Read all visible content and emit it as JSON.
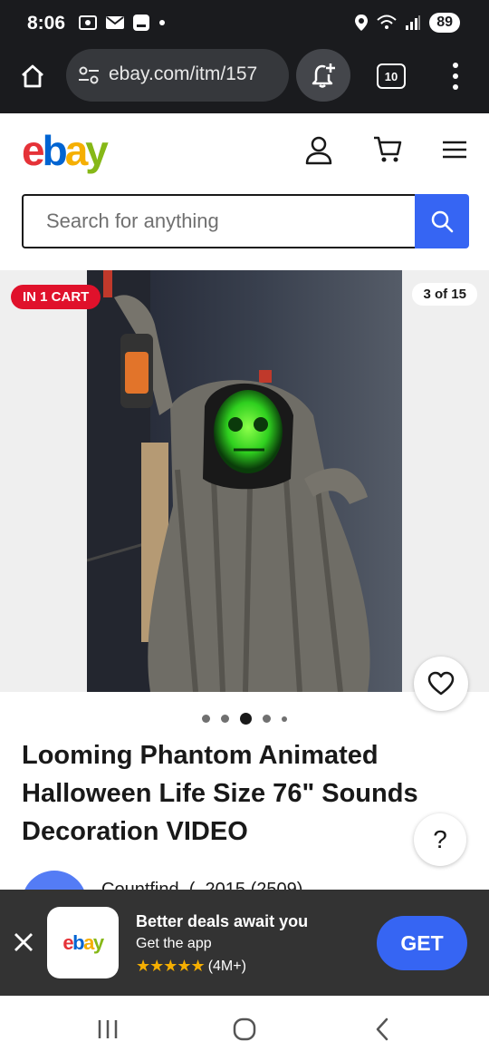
{
  "status_bar": {
    "time": "8:06",
    "battery": "89",
    "icons": [
      "screenshot-icon",
      "mail-icon",
      "message-icon",
      "dot-icon",
      "location-icon",
      "wifi-icon",
      "signal-icon"
    ]
  },
  "browser": {
    "url": "ebay.com/itm/157",
    "tab_count": "10",
    "icons": [
      "home-icon",
      "tune-icon",
      "bell-plus-icon",
      "more-vert-icon"
    ]
  },
  "ebay_header": {
    "logo_letters": [
      "e",
      "b",
      "a",
      "y"
    ],
    "icons": [
      "account-icon",
      "cart-icon",
      "menu-icon"
    ]
  },
  "search": {
    "placeholder": "Search for anything",
    "icons": [
      "search-icon"
    ]
  },
  "gallery": {
    "cart_badge": "IN 1 CART",
    "counter": "3 of 15",
    "dots_total": 5,
    "active_index": 2,
    "icons": [
      "heart-icon"
    ]
  },
  "listing": {
    "title": "Looming Phantom Animated Halloween Life Size 76\" Sounds Decoration VIDEO",
    "seller_peek": "Countfind_(_2015 (2509)",
    "help_label": "?"
  },
  "app_banner": {
    "app_logo_letters": [
      "e",
      "b",
      "a",
      "y"
    ],
    "title": "Better deals await you",
    "subtitle": "Get the app",
    "stars": "★★★★★",
    "rating_count": "(4M+)",
    "cta": "GET",
    "icons": [
      "close-icon"
    ]
  },
  "nav_bar": {
    "icons": [
      "recents-icon",
      "home-circle-icon",
      "back-icon"
    ]
  },
  "colors": {
    "ebay_red": "#e53238",
    "ebay_blue": "#0064d2",
    "ebay_yellow": "#f5af02",
    "ebay_green": "#86b817",
    "primary_blue": "#3665f3",
    "badge_red": "#e0112b"
  }
}
